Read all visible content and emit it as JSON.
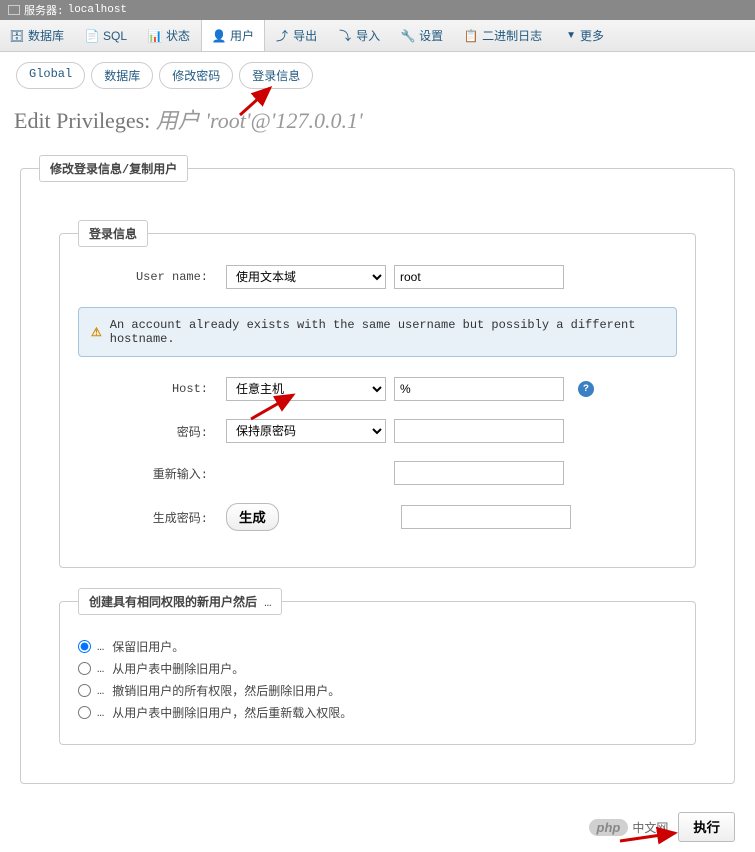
{
  "breadcrumb": {
    "server_label": "服务器:",
    "server_value": "localhost"
  },
  "topnav": {
    "db": "数据库",
    "sql": "SQL",
    "status": "状态",
    "users": "用户",
    "export": "导出",
    "import": "导入",
    "settings": "设置",
    "binlog": "二进制日志",
    "more": "更多"
  },
  "subtabs": {
    "global": "Global",
    "database": "数据库",
    "change_password": "修改密码",
    "login_info": "登录信息"
  },
  "page_title": {
    "prefix": "Edit Privileges: ",
    "user_label": "用户",
    "user_value": "'root'@'127.0.0.1'"
  },
  "outer_legend": "修改登录信息/复制用户",
  "inner_legend": "登录信息",
  "form": {
    "username_label": "User name:",
    "username_select": "使用文本域",
    "username_value": "root",
    "warning_text": "An account already exists with the same username but possibly a different hostname.",
    "host_label": "Host:",
    "host_select": "任意主机",
    "host_value": "%",
    "password_label": "密码:",
    "password_select": "保持原密码",
    "password_value": "",
    "retype_label": "重新输入:",
    "retype_value": "",
    "generate_label": "生成密码:",
    "generate_button": "生成",
    "generate_value": ""
  },
  "after_create": {
    "legend": "创建具有相同权限的新用户然后",
    "legend_dots": "…",
    "opt_keep": "保留旧用户。",
    "opt_delete_from_table": "从用户表中删除旧用户。",
    "opt_revoke_delete": "撤销旧用户的所有权限，然后删除旧用户。",
    "opt_delete_reload": "从用户表中删除旧用户，然后重新载入权限。"
  },
  "footer": {
    "php_badge": "php",
    "php_text": "中文网",
    "execute": "执行"
  }
}
